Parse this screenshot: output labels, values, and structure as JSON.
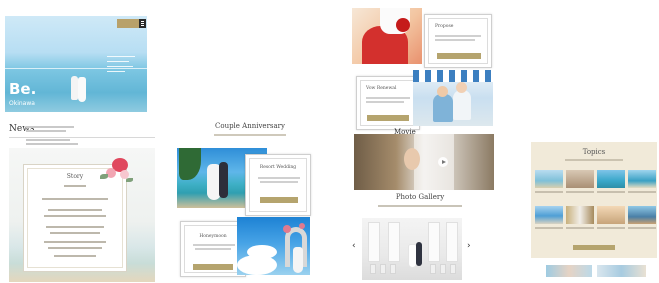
{
  "hero": {
    "brand": "Be.",
    "brand_sub": "Okinawa"
  },
  "news": {
    "title": "News"
  },
  "story": {
    "title": "Story"
  },
  "couple_anniversary": {
    "title": "Couple Anniversary",
    "resort_wedding": {
      "title": "Resort Wedding"
    },
    "honeymoon": {
      "title": "Honeymoon"
    }
  },
  "propose": {
    "title": "Propose"
  },
  "vow_renewal": {
    "title": "Vow Renewal"
  },
  "movie": {
    "title": "Movie"
  },
  "photo_gallery": {
    "title": "Photo Gallery",
    "prev_arrow": "‹",
    "next_arrow": "›"
  },
  "topics": {
    "title": "Topics"
  },
  "colors": {
    "accent_gold": "#b5a46e",
    "topics_bg": "#f1ead9"
  }
}
